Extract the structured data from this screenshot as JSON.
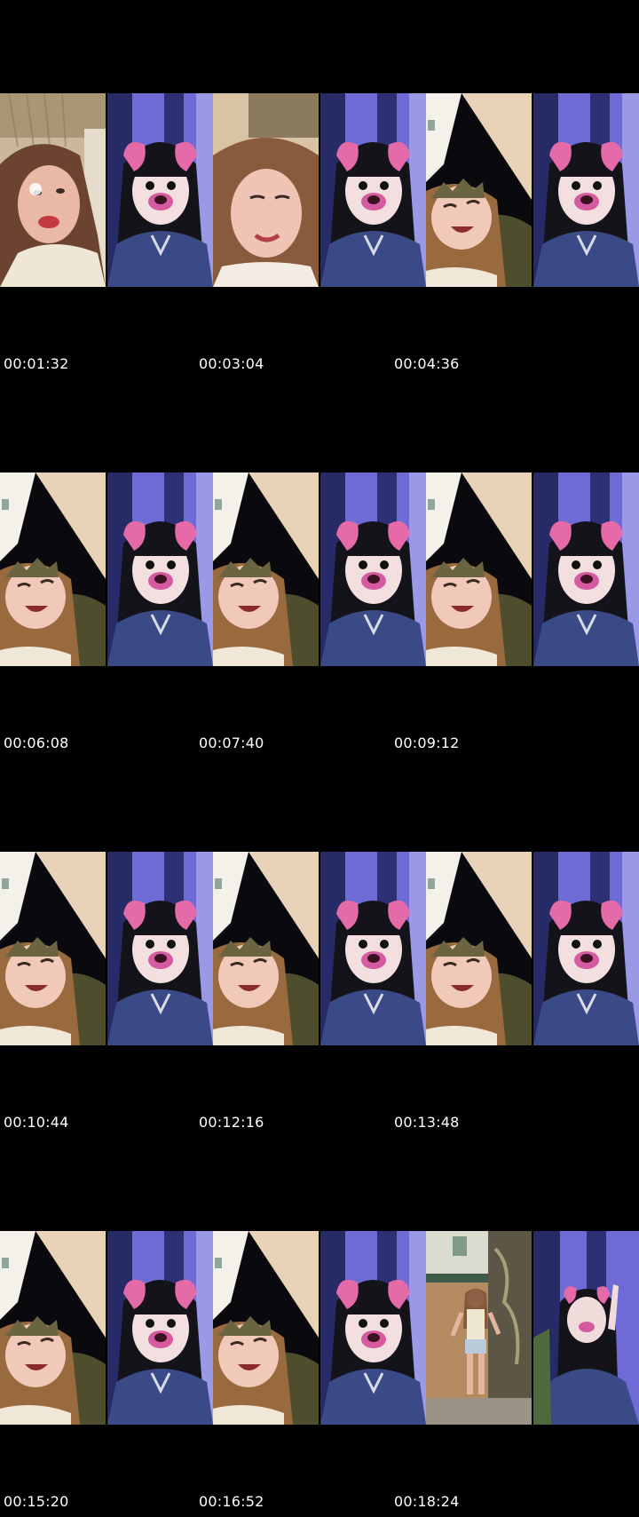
{
  "contact_sheet": {
    "colors": {
      "background": "#000000",
      "timestamp_text": "#ffffff",
      "purple_room": "#6f6bd6",
      "pink_ears": "#e56aa8",
      "warm_room": "#d8c2a0"
    },
    "icons": [
      "video-frame-thumbnail"
    ],
    "rows": [
      {
        "frames": [
          "warm-room-selfie",
          "dog-filter-selfie",
          "warm-room-selfie-closeup",
          "dog-filter-selfie",
          "night-sky-selfie",
          "dog-filter-selfie"
        ],
        "timestamps": [
          "00:01:32",
          "00:03:04",
          "00:04:36"
        ]
      },
      {
        "frames": [
          "night-sky-selfie",
          "dog-filter-selfie",
          "night-sky-selfie",
          "dog-filter-selfie",
          "night-sky-selfie",
          "dog-filter-selfie"
        ],
        "timestamps": [
          "00:06:08",
          "00:07:40",
          "00:09:12"
        ]
      },
      {
        "frames": [
          "night-sky-selfie",
          "dog-filter-selfie",
          "night-sky-selfie",
          "dog-filter-selfie",
          "night-sky-selfie",
          "dog-filter-selfie"
        ],
        "timestamps": [
          "00:10:44",
          "00:12:16",
          "00:13:48"
        ]
      },
      {
        "frames": [
          "night-sky-selfie",
          "dog-filter-selfie",
          "night-sky-selfie",
          "dog-filter-selfie",
          "street-dance",
          "dog-filter-selfie-wave"
        ],
        "timestamps": [
          "00:15:20",
          "00:16:52",
          "00:18:24"
        ]
      }
    ]
  }
}
